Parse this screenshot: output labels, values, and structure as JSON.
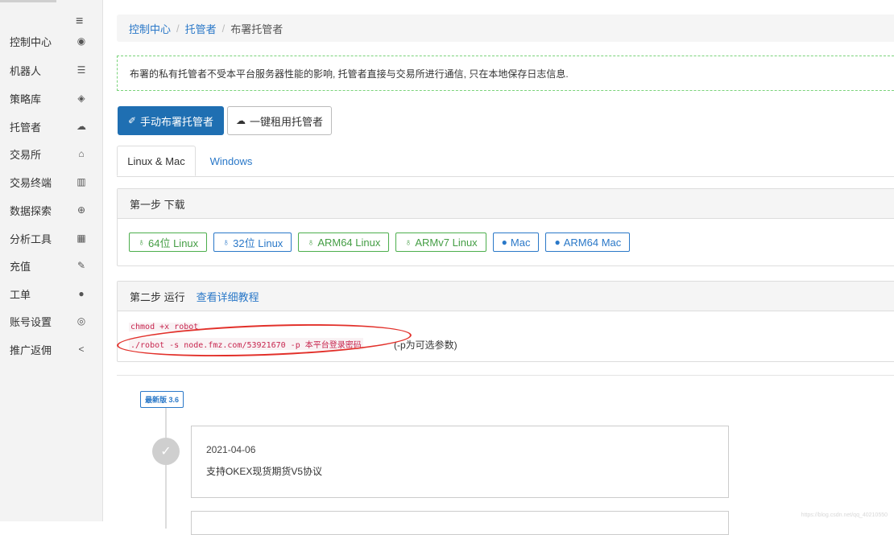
{
  "sidebar": {
    "menu_icon": "≡",
    "items": [
      {
        "label": "控制中心",
        "icon": "dashboard-icon",
        "glyph": "◉"
      },
      {
        "label": "机器人",
        "icon": "server-icon",
        "glyph": "☰"
      },
      {
        "label": "策略库",
        "icon": "shield-icon",
        "glyph": "◈"
      },
      {
        "label": "托管者",
        "icon": "cloud-icon",
        "glyph": "☁"
      },
      {
        "label": "交易所",
        "icon": "bank-icon",
        "glyph": "⌂"
      },
      {
        "label": "交易终端",
        "icon": "bar-chart-icon",
        "glyph": "▥"
      },
      {
        "label": "数据探索",
        "icon": "search-icon",
        "glyph": "⊕"
      },
      {
        "label": "分析工具",
        "icon": "calculator-icon",
        "glyph": "▦"
      },
      {
        "label": "充值",
        "icon": "magic-icon",
        "glyph": "✎"
      },
      {
        "label": "工单",
        "icon": "comment-icon",
        "glyph": "●"
      },
      {
        "label": "账号设置",
        "icon": "user-circle-icon",
        "glyph": "◎"
      },
      {
        "label": "推广返佣",
        "icon": "share-icon",
        "glyph": "<"
      }
    ]
  },
  "breadcrumb": {
    "home": "控制中心",
    "parent": "托管者",
    "sep": "/",
    "current": "布署托管者"
  },
  "notice": "布署的私有托管者不受本平台服务器性能的影响, 托管者直接与交易所进行通信, 只在本地保存日志信息.",
  "buttons": {
    "manual": "手动布署托管者",
    "manual_glyph": "✐",
    "rent": "一键租用托管者",
    "rent_glyph": "☁"
  },
  "tabs": {
    "active": "Linux & Mac",
    "other": "Windows"
  },
  "step1": {
    "title": "第一步 下载",
    "downloads": [
      {
        "label": "64位 Linux",
        "glyph": "♁",
        "style": "g"
      },
      {
        "label": "32位 Linux",
        "glyph": "♁",
        "style": "b"
      },
      {
        "label": "ARM64 Linux",
        "glyph": "♁",
        "style": "g"
      },
      {
        "label": "ARMv7 Linux",
        "glyph": "♁",
        "style": "g"
      },
      {
        "label": "Mac",
        "glyph": "●",
        "style": "b"
      },
      {
        "label": "ARM64 Mac",
        "glyph": "●",
        "style": "b"
      }
    ]
  },
  "step2": {
    "title": "第二步 运行",
    "tutorial_link": "查看详细教程",
    "cmd1": "chmod +x robot",
    "cmd2": "./robot -s node.fmz.com/53921670 -p 本平台登录密码",
    "param_note": "(-p为可选参数)"
  },
  "timeline": {
    "version_badge": "最新版 3.6",
    "check_glyph": "✓",
    "date": "2021-04-06",
    "text": "支持OKEX现货期货V5协议"
  },
  "watermark": "https://blog.csdn.net/qq_40210550"
}
